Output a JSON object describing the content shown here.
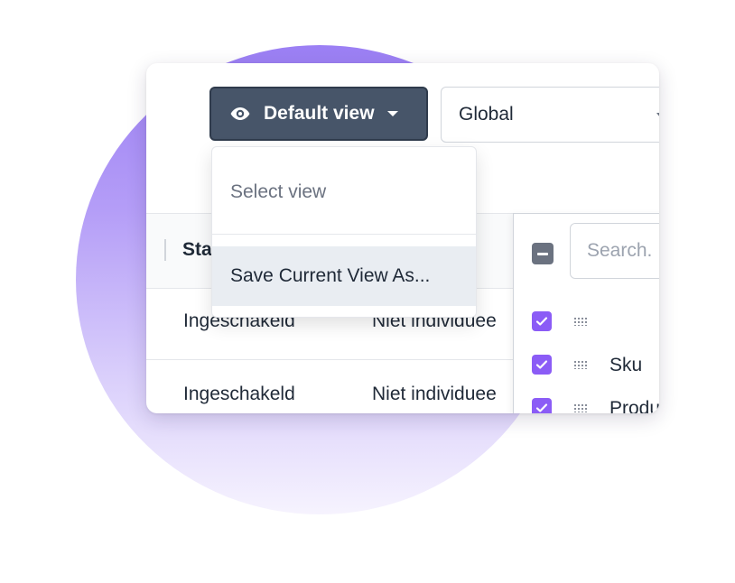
{
  "toolbar": {
    "view_button_label": "Default view",
    "view_button_icon": "eye-icon",
    "scope_select_value": "Global"
  },
  "view_dropdown": {
    "placeholder": "Select view",
    "save_item": "Save Current View As..."
  },
  "table": {
    "columns": [
      "Sta"
    ],
    "rows": [
      [
        "Ingeschakeld",
        "Niet individuee"
      ],
      [
        "Ingeschakeld",
        "Niet individuee"
      ]
    ]
  },
  "column_panel": {
    "search_placeholder": "Search.",
    "items": [
      {
        "label": "",
        "checked": true
      },
      {
        "label": "Sku",
        "checked": true
      },
      {
        "label": "Produ",
        "checked": true
      }
    ]
  },
  "colors": {
    "accent_purple": "#8b5cf6",
    "button_slate": "#475569"
  }
}
